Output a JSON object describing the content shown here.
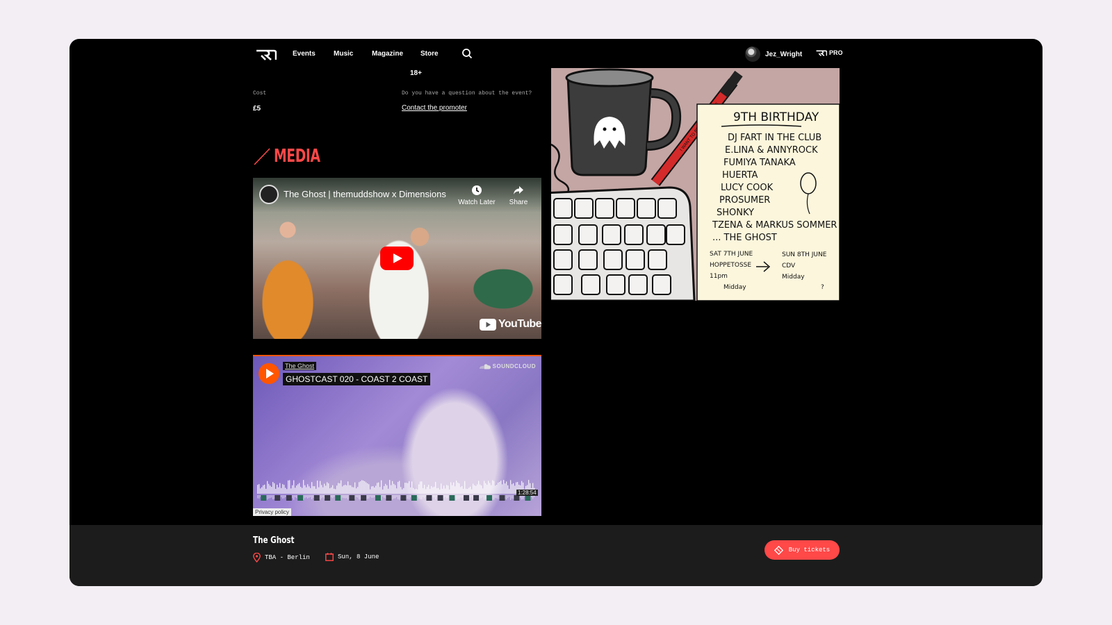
{
  "nav": {
    "items": [
      "Events",
      "Music",
      "Magazine",
      "Store"
    ],
    "username": "Jez_Wright",
    "pro_label": "PRO"
  },
  "info": {
    "age": "18+",
    "cost_label": "Cost",
    "cost_value": "£5",
    "question_label": "Do you have a question about the event?",
    "contact_link": "Contact the promoter"
  },
  "media": {
    "heading": "MEDIA",
    "youtube": {
      "title": "The Ghost | themuddshow x Dimensions",
      "watch_later": "Watch Later",
      "share": "Share",
      "brand": "YouTube"
    },
    "soundcloud": {
      "artist": "The Ghost",
      "track": "GHOSTCAST 020 - COAST 2 COAST",
      "brand": "SOUNDCLOUD",
      "duration": "1:28:54",
      "privacy": "Privacy policy"
    }
  },
  "flyer": {
    "title": "9TH BIRTHDAY",
    "lineup": [
      "DJ FART IN THE CLUB",
      "E.LINA & ANNYROCK",
      "FUMIYA TANAKA",
      "HUERTA",
      "LUCY COOK",
      "PROSUMER",
      "SHONKY",
      "TZENA & MARKUS SOMMER",
      "... THE GHOST"
    ],
    "day1": [
      "SAT 7TH JUNE",
      "HOPPETOSSE",
      "11pm",
      "Midday"
    ],
    "day2": [
      "SUN 8TH JUNE",
      "CDV",
      "Midday",
      "?"
    ],
    "pen_text": "I WANT TO BE SO ALL ALONE"
  },
  "footer": {
    "event_title": "The Ghost",
    "venue": "TBA - Berlin",
    "date": "Sun, 8 June",
    "buy_label": "Buy tickets"
  },
  "colors": {
    "accent": "#ff4848",
    "soundcloud": "#ff5500",
    "youtube": "#ff0000",
    "page_bg": "#000000",
    "footer_bg": "#1c1c1c"
  }
}
